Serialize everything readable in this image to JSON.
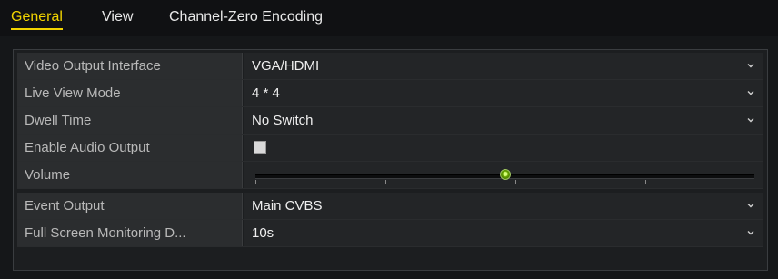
{
  "tabs": [
    {
      "label": "General",
      "active": true
    },
    {
      "label": "View",
      "active": false
    },
    {
      "label": "Channel-Zero Encoding",
      "active": false
    }
  ],
  "settings": {
    "video_output_interface": {
      "label": "Video Output Interface",
      "value": "VGA/HDMI"
    },
    "live_view_mode": {
      "label": "Live View Mode",
      "value": "4 * 4"
    },
    "dwell_time": {
      "label": "Dwell Time",
      "value": "No Switch"
    },
    "enable_audio_output": {
      "label": "Enable Audio Output",
      "checked": false
    },
    "volume": {
      "label": "Volume",
      "level_fraction": 0.5
    },
    "event_output": {
      "label": "Event Output",
      "value": "Main CVBS"
    },
    "full_screen_monitoring": {
      "label": "Full Screen Monitoring D...",
      "value": "10s"
    }
  },
  "icons": {
    "dropdown": "chevron-down-icon"
  },
  "colors": {
    "active_tab": "#f2d400",
    "slider_knob": "#6aa800"
  }
}
